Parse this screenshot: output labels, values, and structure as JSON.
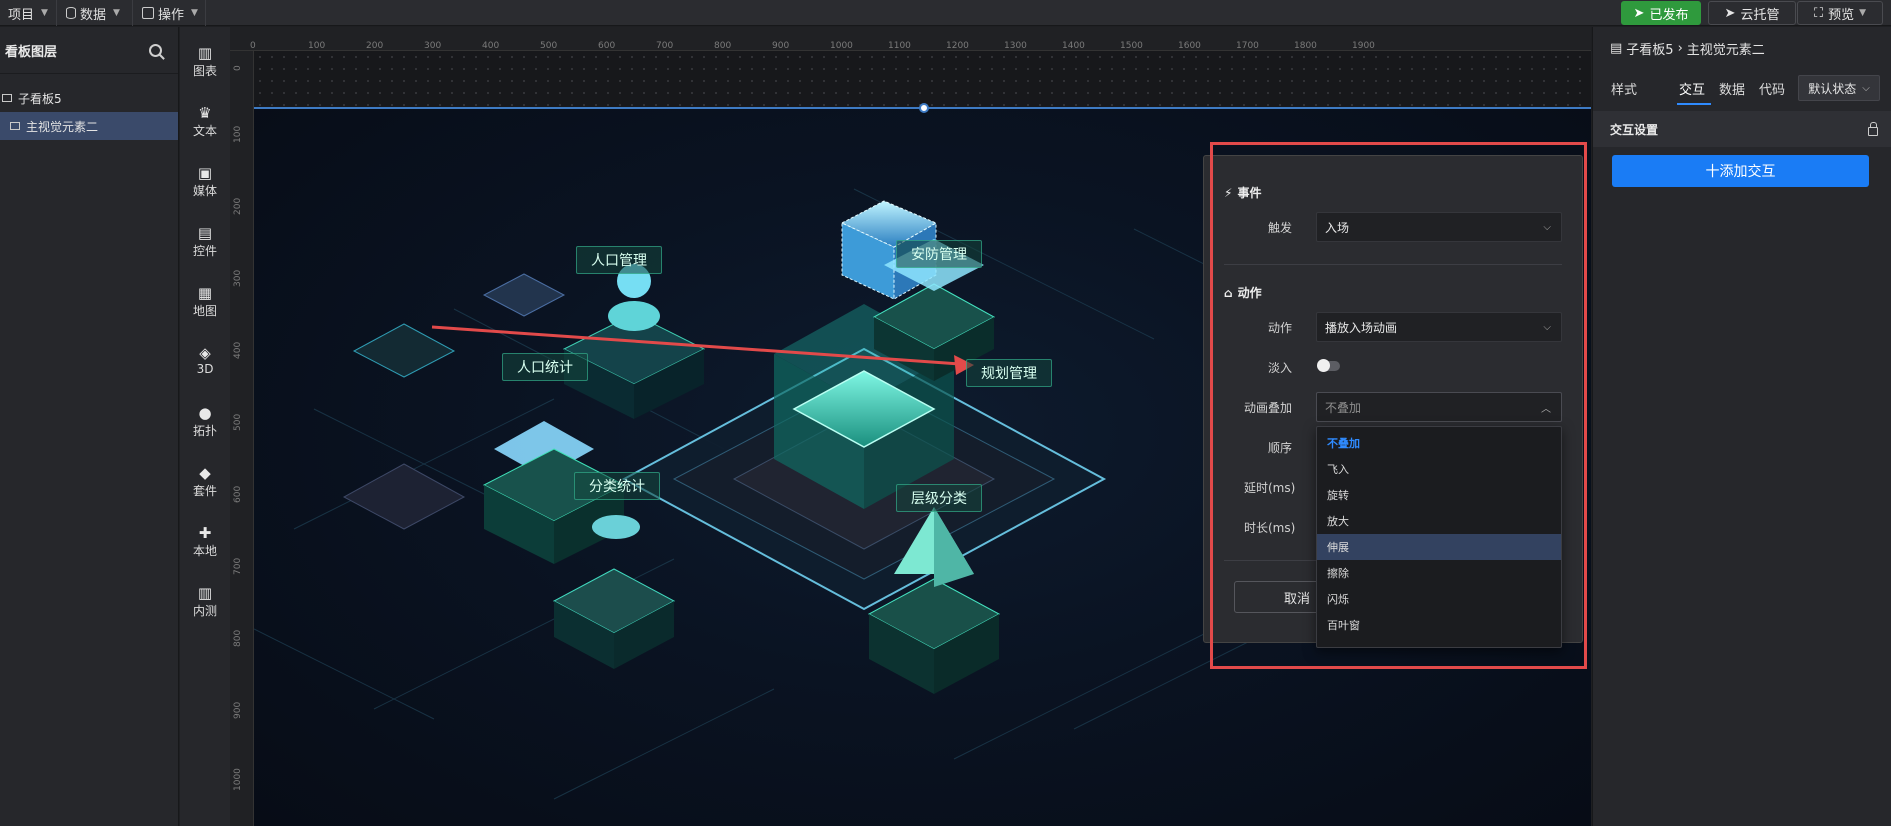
{
  "topbar": {
    "menus": [
      {
        "label": "项目",
        "icon": "none"
      },
      {
        "label": "数据",
        "icon": "database-icon"
      },
      {
        "label": "操作",
        "icon": "grid-icon"
      }
    ],
    "publish_label": "已发布",
    "cloud_label": "云托管",
    "preview_label": "预览"
  },
  "layers": {
    "title": "看板图层",
    "items": [
      {
        "label": "子看板5",
        "selected": false
      },
      {
        "label": "主视觉元素二",
        "selected": true
      }
    ]
  },
  "components": [
    {
      "label": "图表",
      "icon": "bar-chart-icon",
      "glyph": "▥"
    },
    {
      "label": "文本",
      "icon": "crown-text-icon",
      "glyph": "♛"
    },
    {
      "label": "媒体",
      "icon": "media-icon",
      "glyph": "▣"
    },
    {
      "label": "控件",
      "icon": "widget-icon",
      "glyph": "▤"
    },
    {
      "label": "地图",
      "icon": "map-icon",
      "glyph": "▦"
    },
    {
      "label": "3D",
      "icon": "cube-icon",
      "glyph": "◈"
    },
    {
      "label": "拓扑",
      "icon": "topology-icon",
      "glyph": "●"
    },
    {
      "label": "套件",
      "icon": "shirt-icon",
      "glyph": "◆"
    },
    {
      "label": "本地",
      "icon": "puzzle-icon",
      "glyph": "✚"
    },
    {
      "label": "内测",
      "icon": "chart-beta-icon",
      "glyph": "▥"
    }
  ],
  "ruler": {
    "h_ticks": [
      "0",
      "100",
      "200",
      "300",
      "400",
      "500",
      "600",
      "700",
      "800",
      "900",
      "1000",
      "1100",
      "1200",
      "1300",
      "1400",
      "1500",
      "1600",
      "1700",
      "1800",
      "1900"
    ],
    "v_ticks": [
      "0",
      "100",
      "200",
      "300",
      "400",
      "500",
      "600",
      "700",
      "800",
      "900",
      "1000"
    ]
  },
  "scene": {
    "labels": [
      "人口管理",
      "安防管理",
      "人口统计",
      "规划管理",
      "分类统计",
      "层级分类"
    ]
  },
  "modal": {
    "event_section": "事件",
    "trigger_label": "触发",
    "trigger_value": "入场",
    "action_section": "动作",
    "action_label": "动作",
    "action_value": "播放入场动画",
    "fade_label": "淡入",
    "fade_on": false,
    "overlay_label": "动画叠加",
    "overlay_placeholder": "不叠加",
    "order_label": "顺序",
    "delay_label": "延时(ms)",
    "duration_label": "时长(ms)",
    "cancel_label": "取消",
    "dropdown_options": [
      {
        "label": "不叠加",
        "active": true,
        "highlight": false
      },
      {
        "label": "飞入",
        "active": false,
        "highlight": false
      },
      {
        "label": "旋转",
        "active": false,
        "highlight": false
      },
      {
        "label": "放大",
        "active": false,
        "highlight": false
      },
      {
        "label": "伸展",
        "active": false,
        "highlight": true
      },
      {
        "label": "擦除",
        "active": false,
        "highlight": false
      },
      {
        "label": "闪烁",
        "active": false,
        "highlight": false
      },
      {
        "label": "百叶窗",
        "active": false,
        "highlight": false
      }
    ]
  },
  "right_panel": {
    "breadcrumb_parent": "子看板5",
    "breadcrumb_current": "主视觉元素二",
    "tabs": [
      "样式",
      "交互",
      "数据",
      "代码"
    ],
    "active_tab": "交互",
    "state_label": "默认状态",
    "section_title": "交互设置",
    "add_button": "十添加交互"
  },
  "colors": {
    "accent": "#1a7cf5",
    "publish": "#2f9a3d",
    "highlight_box": "#e24a4a",
    "guide": "#3e7bc4"
  }
}
